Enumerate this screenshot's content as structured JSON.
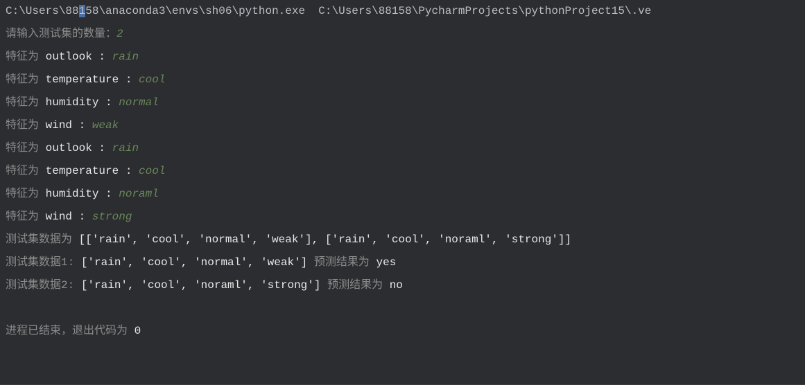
{
  "console": {
    "path_line": {
      "prefix": "C:\\Users\\88",
      "highlight": "1",
      "suffix": "58\\anaconda3\\envs\\sh06\\python.exe  C:\\Users\\88158\\PycharmProjects\\pythonProject15\\.ve"
    },
    "input_prompt": {
      "label": "请输入测试集的数量：",
      "value": "2"
    },
    "features": [
      {
        "prefix": "特征为 ",
        "name": "outlook",
        "colon": " : ",
        "value": "rain"
      },
      {
        "prefix": "特征为 ",
        "name": "temperature",
        "colon": " : ",
        "value": "cool"
      },
      {
        "prefix": "特征为 ",
        "name": "humidity",
        "colon": " : ",
        "value": "normal"
      },
      {
        "prefix": "特征为 ",
        "name": "wind",
        "colon": " : ",
        "value": "weak"
      },
      {
        "prefix": "特征为 ",
        "name": "outlook",
        "colon": " : ",
        "value": "rain"
      },
      {
        "prefix": "特征为 ",
        "name": "temperature",
        "colon": " : ",
        "value": "cool"
      },
      {
        "prefix": "特征为 ",
        "name": "humidity",
        "colon": " : ",
        "value": "noraml"
      },
      {
        "prefix": "特征为 ",
        "name": "wind",
        "colon": " : ",
        "value": "strong"
      }
    ],
    "test_data": {
      "label": "测试集数据为 ",
      "value": "[['rain', 'cool', 'normal', 'weak'], ['rain', 'cool', 'noraml', 'strong']]"
    },
    "predictions": [
      {
        "label": "测试集数据1: ",
        "data": "['rain', 'cool', 'normal', 'weak']",
        "result_label": " 预测结果为 ",
        "result": "yes"
      },
      {
        "label": "测试集数据2: ",
        "data": "['rain', 'cool', 'noraml', 'strong']",
        "result_label": " 预测结果为 ",
        "result": "no"
      }
    ],
    "exit_message": {
      "prefix": "进程已结束，退出代码为 ",
      "code": "0"
    }
  }
}
